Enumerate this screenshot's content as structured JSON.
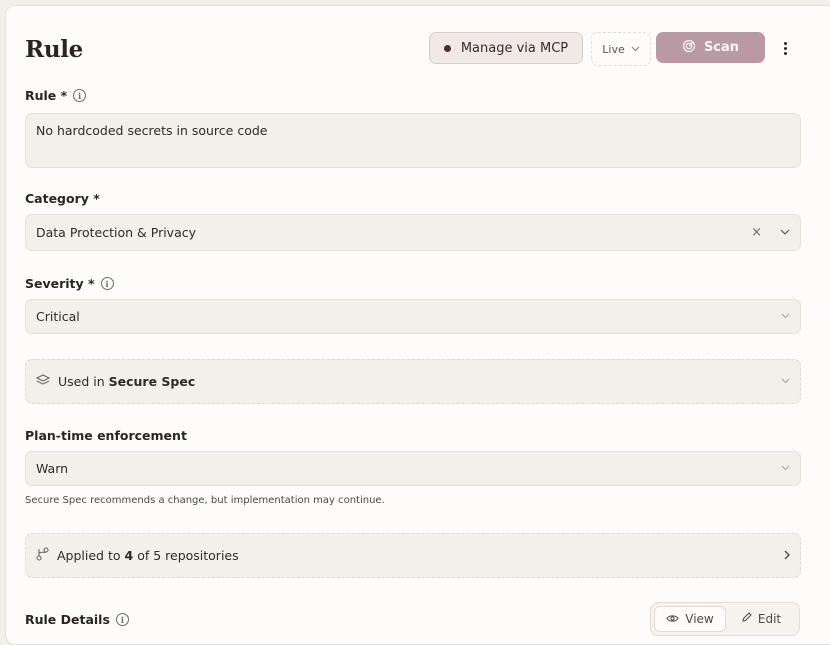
{
  "header": {
    "title": "Rule",
    "mcp_label": "Manage via MCP",
    "live_label": "Live",
    "scan_label": "Scan"
  },
  "rule": {
    "label": "Rule *",
    "value": "No hardcoded secrets in source code"
  },
  "category": {
    "label": "Category *",
    "value": "Data Protection & Privacy"
  },
  "severity": {
    "label": "Severity *",
    "value": "Critical"
  },
  "used_in": {
    "prefix": "Used in",
    "name": "Secure Spec"
  },
  "plan_time": {
    "label": "Plan-time enforcement",
    "value": "Warn",
    "helper": "Secure Spec recommends a change, but implementation may continue."
  },
  "applied": {
    "prefix": "Applied to",
    "count": "4",
    "suffix": "of 5 repositories"
  },
  "details": {
    "label": "Rule Details",
    "view_label": "View",
    "edit_label": "Edit"
  },
  "icons": {
    "info": "info-icon",
    "chevron": "chevron-down-icon",
    "layers": "layers-icon",
    "branch": "git-branch-icon",
    "scan": "scan-icon",
    "eye": "eye-icon",
    "pencil": "pencil-icon"
  },
  "colors": {
    "accent": "#b99aa4",
    "mcp_bg": "#f1e9e6",
    "field_bg": "#f3efea"
  }
}
